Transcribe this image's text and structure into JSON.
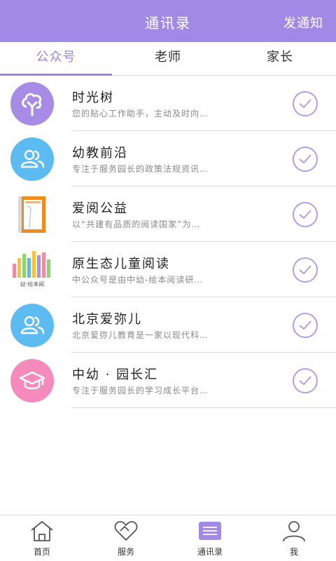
{
  "header": {
    "title": "通讯录",
    "action": "发通知"
  },
  "tabs": [
    {
      "label": "公众号",
      "active": true
    },
    {
      "label": "老师",
      "active": false
    },
    {
      "label": "家长",
      "active": false
    }
  ],
  "accounts": [
    {
      "name": "时光树",
      "desc": "您的贴心工作助手，主动及时向…",
      "icon": "tree-icon"
    },
    {
      "name": "幼教前沿",
      "desc": "专注于服务园长的政策法规资讯…",
      "icon": "people-icon"
    },
    {
      "name": "爱阅公益",
      "desc": "以“共建有品质的阅读国家”为…",
      "icon": "book-logo"
    },
    {
      "name": "原生态儿童阅读",
      "desc": "中公众号是由中幼-绘本阅读研…",
      "icon": "picture-book-logo",
      "logo_text": "幼·绘本阅"
    },
    {
      "name": "北京爱弥儿",
      "desc": "北京爱弥儿教育是一家以现代科…",
      "icon": "people-icon"
    },
    {
      "name": "中幼 · 园长汇",
      "desc": "专注于服务园长的学习成长平台…",
      "icon": "graduation-cap-icon"
    }
  ],
  "tabbar": [
    {
      "label": "首页",
      "icon": "home-icon"
    },
    {
      "label": "服务",
      "icon": "heart-handshake-icon"
    },
    {
      "label": "通讯录",
      "icon": "contacts-icon",
      "active": true
    },
    {
      "label": "我",
      "icon": "user-icon"
    }
  ],
  "colors": {
    "accent": "#a08ae6",
    "blue": "#5cbcf2",
    "pink": "#f58bbc"
  }
}
